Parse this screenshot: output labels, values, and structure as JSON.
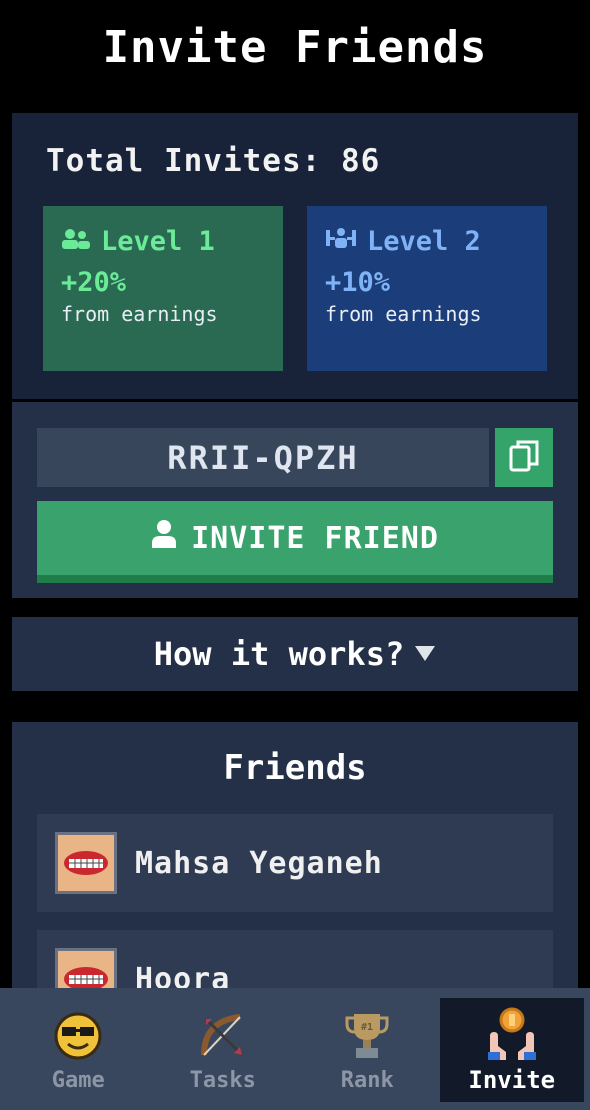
{
  "header": {
    "title": "Invite Friends"
  },
  "summary": {
    "total_invites": "Total Invites: 86",
    "levels": [
      {
        "label": "Level 1",
        "percent": "+20%",
        "note": "from earnings",
        "icon": "users-icon",
        "color": "#6bea97"
      },
      {
        "label": "Level 2",
        "percent": "+10%",
        "note": "from earnings",
        "icon": "network-icon",
        "color": "#7fb3f5"
      }
    ]
  },
  "invite": {
    "code": "RRII-QPZH",
    "button_label": "INVITE FRIEND",
    "copy_icon": "copy-icon"
  },
  "how_it_works": {
    "label": "How it works?"
  },
  "friends": {
    "title": "Friends",
    "items": [
      {
        "name": "Mahsa Yeganeh"
      },
      {
        "name": "Hoora"
      }
    ]
  },
  "nav": {
    "items": [
      {
        "label": "Game",
        "icon": "smiley-sunglasses-icon"
      },
      {
        "label": "Tasks",
        "icon": "bow-arrow-icon"
      },
      {
        "label": "Rank",
        "icon": "trophy-icon"
      },
      {
        "label": "Invite",
        "icon": "hands-coin-icon",
        "active": true
      }
    ]
  },
  "colors": {
    "accent_green": "#3aa36d",
    "card_bg": "#18233a",
    "panel_bg": "#243047",
    "nav_bg": "#38475e"
  }
}
